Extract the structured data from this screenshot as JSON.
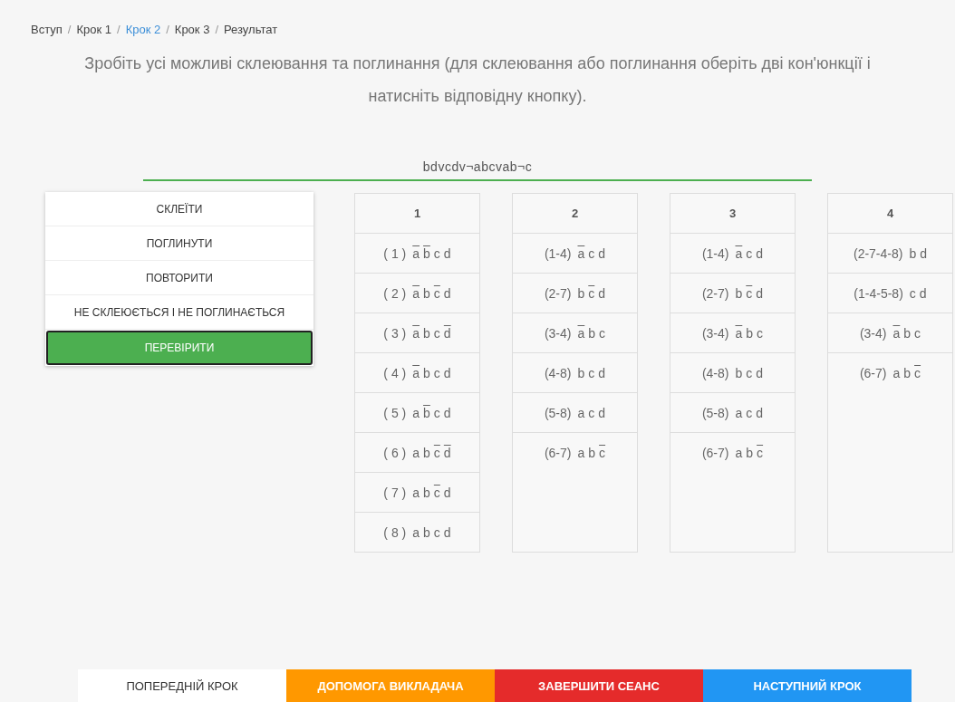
{
  "breadcrumb_separator": "/",
  "breadcrumb": [
    {
      "label": "Вступ",
      "selected": false
    },
    {
      "label": "Крок 1",
      "selected": false
    },
    {
      "label": "Крок 2",
      "selected": true
    },
    {
      "label": "Крок 3",
      "selected": false
    },
    {
      "label": "Результат",
      "selected": false
    }
  ],
  "instruction": "Зробіть усі можливі склеювання та поглинання (для склеювання або поглинання оберіть дві кон'юнкції і натисніть відповідну кнопку).",
  "formula": "bdvcdv¬abcvab¬c",
  "actions": [
    {
      "label": "СКЛЕЇТИ",
      "kind": "plain"
    },
    {
      "label": "ПОГЛИНУТИ",
      "kind": "plain"
    },
    {
      "label": "ПОВТОРИТИ",
      "kind": "plain"
    },
    {
      "label": "НЕ СКЛЕЮЄТЬСЯ І НЕ ПОГЛИНАЄТЬСЯ",
      "kind": "plain"
    },
    {
      "label": "ПЕРЕВІРИТИ",
      "kind": "primary"
    }
  ],
  "columns": [
    {
      "header": "1",
      "terms": [
        {
          "label": "( 1 )",
          "literals": [
            {
              "letter": "a",
              "negated": true
            },
            {
              "letter": "b",
              "negated": true
            },
            {
              "letter": "c",
              "negated": false
            },
            {
              "letter": "d",
              "negated": false
            }
          ]
        },
        {
          "label": "( 2 )",
          "literals": [
            {
              "letter": "a",
              "negated": true
            },
            {
              "letter": "b",
              "negated": false
            },
            {
              "letter": "c",
              "negated": true
            },
            {
              "letter": "d",
              "negated": false
            }
          ]
        },
        {
          "label": "( 3 )",
          "literals": [
            {
              "letter": "a",
              "negated": true
            },
            {
              "letter": "b",
              "negated": false
            },
            {
              "letter": "c",
              "negated": false
            },
            {
              "letter": "d",
              "negated": true
            }
          ]
        },
        {
          "label": "( 4 )",
          "literals": [
            {
              "letter": "a",
              "negated": true
            },
            {
              "letter": "b",
              "negated": false
            },
            {
              "letter": "c",
              "negated": false
            },
            {
              "letter": "d",
              "negated": false
            }
          ]
        },
        {
          "label": "( 5 )",
          "literals": [
            {
              "letter": "a",
              "negated": false
            },
            {
              "letter": "b",
              "negated": true
            },
            {
              "letter": "c",
              "negated": false
            },
            {
              "letter": "d",
              "negated": false
            }
          ]
        },
        {
          "label": "( 6 )",
          "literals": [
            {
              "letter": "a",
              "negated": false
            },
            {
              "letter": "b",
              "negated": false
            },
            {
              "letter": "c",
              "negated": true
            },
            {
              "letter": "d",
              "negated": true
            }
          ]
        },
        {
          "label": "( 7 )",
          "literals": [
            {
              "letter": "a",
              "negated": false
            },
            {
              "letter": "b",
              "negated": false
            },
            {
              "letter": "c",
              "negated": true
            },
            {
              "letter": "d",
              "negated": false
            }
          ]
        },
        {
          "label": "( 8 )",
          "literals": [
            {
              "letter": "a",
              "negated": false
            },
            {
              "letter": "b",
              "negated": false
            },
            {
              "letter": "c",
              "negated": false
            },
            {
              "letter": "d",
              "negated": false
            }
          ]
        }
      ]
    },
    {
      "header": "2",
      "terms": [
        {
          "label": "(1-4)",
          "literals": [
            {
              "letter": "a",
              "negated": true
            },
            {
              "letter": "c",
              "negated": false
            },
            {
              "letter": "d",
              "negated": false
            }
          ]
        },
        {
          "label": "(2-7)",
          "literals": [
            {
              "letter": "b",
              "negated": false
            },
            {
              "letter": "c",
              "negated": true
            },
            {
              "letter": "d",
              "negated": false
            }
          ]
        },
        {
          "label": "(3-4)",
          "literals": [
            {
              "letter": "a",
              "negated": true
            },
            {
              "letter": "b",
              "negated": false
            },
            {
              "letter": "c",
              "negated": false
            }
          ]
        },
        {
          "label": "(4-8)",
          "literals": [
            {
              "letter": "b",
              "negated": false
            },
            {
              "letter": "c",
              "negated": false
            },
            {
              "letter": "d",
              "negated": false
            }
          ]
        },
        {
          "label": "(5-8)",
          "literals": [
            {
              "letter": "a",
              "negated": false
            },
            {
              "letter": "c",
              "negated": false
            },
            {
              "letter": "d",
              "negated": false
            }
          ]
        },
        {
          "label": "(6-7)",
          "literals": [
            {
              "letter": "a",
              "negated": false
            },
            {
              "letter": "b",
              "negated": false
            },
            {
              "letter": "c",
              "negated": true
            }
          ]
        }
      ]
    },
    {
      "header": "3",
      "terms": [
        {
          "label": "(1-4)",
          "literals": [
            {
              "letter": "a",
              "negated": true
            },
            {
              "letter": "c",
              "negated": false
            },
            {
              "letter": "d",
              "negated": false
            }
          ]
        },
        {
          "label": "(2-7)",
          "literals": [
            {
              "letter": "b",
              "negated": false
            },
            {
              "letter": "c",
              "negated": true
            },
            {
              "letter": "d",
              "negated": false
            }
          ]
        },
        {
          "label": "(3-4)",
          "literals": [
            {
              "letter": "a",
              "negated": true
            },
            {
              "letter": "b",
              "negated": false
            },
            {
              "letter": "c",
              "negated": false
            }
          ]
        },
        {
          "label": "(4-8)",
          "literals": [
            {
              "letter": "b",
              "negated": false
            },
            {
              "letter": "c",
              "negated": false
            },
            {
              "letter": "d",
              "negated": false
            }
          ]
        },
        {
          "label": "(5-8)",
          "literals": [
            {
              "letter": "a",
              "negated": false
            },
            {
              "letter": "c",
              "negated": false
            },
            {
              "letter": "d",
              "negated": false
            }
          ]
        },
        {
          "label": "(6-7)",
          "literals": [
            {
              "letter": "a",
              "negated": false
            },
            {
              "letter": "b",
              "negated": false
            },
            {
              "letter": "c",
              "negated": true
            }
          ]
        }
      ]
    },
    {
      "header": "4",
      "terms": [
        {
          "label": "(2-7-4-8)",
          "literals": [
            {
              "letter": "b",
              "negated": false
            },
            {
              "letter": "d",
              "negated": false
            }
          ]
        },
        {
          "label": "(1-4-5-8)",
          "literals": [
            {
              "letter": "c",
              "negated": false
            },
            {
              "letter": "d",
              "negated": false
            }
          ]
        },
        {
          "label": "(3-4)",
          "literals": [
            {
              "letter": "a",
              "negated": true
            },
            {
              "letter": "b",
              "negated": false
            },
            {
              "letter": "c",
              "negated": false
            }
          ]
        },
        {
          "label": "(6-7)",
          "literals": [
            {
              "letter": "a",
              "negated": false
            },
            {
              "letter": "b",
              "negated": false
            },
            {
              "letter": "c",
              "negated": true
            }
          ]
        }
      ]
    }
  ],
  "footer": [
    {
      "label": "ПОПЕРЕДНІЙ КРОК",
      "kind": "plain"
    },
    {
      "label": "ДОПОМОГА ВИКЛАДАЧА",
      "kind": "help"
    },
    {
      "label": "ЗАВЕРШИТИ СЕАНС",
      "kind": "end"
    },
    {
      "label": "НАСТУПНИЙ КРОК",
      "kind": "next"
    }
  ]
}
